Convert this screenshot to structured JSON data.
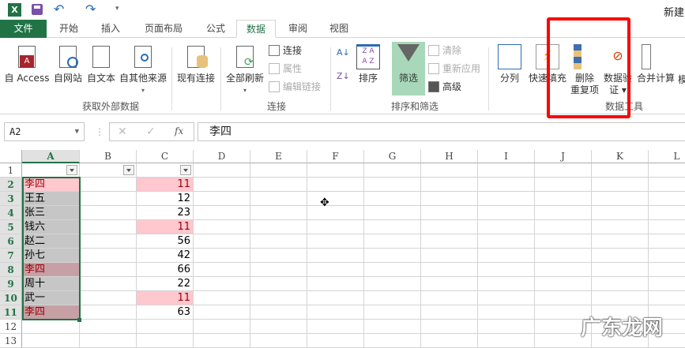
{
  "title_bar": {
    "doc_title": "新建",
    "excel_icon": "excel-logo-icon",
    "save_icon": "save-icon",
    "undo_icon": "undo-icon",
    "redo_icon": "redo-icon",
    "customize_icon": "customize-qat-icon"
  },
  "tabs": [
    "文件",
    "开始",
    "插入",
    "页面布局",
    "公式",
    "数据",
    "审阅",
    "视图"
  ],
  "active_tab": "数据",
  "ribbon": {
    "external": {
      "group": "获取外部数据",
      "access": "自 Access",
      "web": "自网站",
      "text": "自文本",
      "other": "自其他来源",
      "existing": "现有连接"
    },
    "connections": {
      "group": "连接",
      "refresh_all": "全部刷新",
      "connections": "连接",
      "properties": "属性",
      "edit_links": "编辑链接"
    },
    "sort_filter": {
      "group": "排序和筛选",
      "sort": "排序",
      "filter": "筛选",
      "clear": "清除",
      "reapply": "重新应用",
      "advanced": "高级"
    },
    "data_tools": {
      "group": "数据工具",
      "text_to_columns": "分列",
      "flash_fill": "快速填充",
      "remove_dup_1": "删除",
      "remove_dup_2": "重复项",
      "validation_1": "数据验",
      "validation_2": "证",
      "consolidate": "合并计算",
      "more": "模"
    }
  },
  "highlight_color": "#ff0000",
  "formula_bar": {
    "name_box": "A2",
    "formula": "李四"
  },
  "columns": [
    "A",
    "B",
    "C",
    "D",
    "E",
    "F",
    "G",
    "H",
    "I",
    "J",
    "K",
    "L"
  ],
  "rows": [
    {
      "n": "1",
      "a": "",
      "c": ""
    },
    {
      "n": "2",
      "a": "李四",
      "c": "11",
      "a_dup": true,
      "c_dup": true
    },
    {
      "n": "3",
      "a": "王五",
      "c": "12"
    },
    {
      "n": "4",
      "a": "张三",
      "c": "23"
    },
    {
      "n": "5",
      "a": "钱六",
      "c": "11",
      "c_dup": true
    },
    {
      "n": "6",
      "a": "赵二",
      "c": "56"
    },
    {
      "n": "7",
      "a": "孙七",
      "c": "42"
    },
    {
      "n": "8",
      "a": "李四",
      "c": "66",
      "a_dup": true
    },
    {
      "n": "9",
      "a": "周十",
      "c": "22"
    },
    {
      "n": "10",
      "a": "武一",
      "c": "11",
      "c_dup": true
    },
    {
      "n": "11",
      "a": "李四",
      "c": "63",
      "a_dup": true
    },
    {
      "n": "12",
      "a": "",
      "c": ""
    },
    {
      "n": "13",
      "a": "",
      "c": ""
    }
  ],
  "watermark": "广东龙网"
}
